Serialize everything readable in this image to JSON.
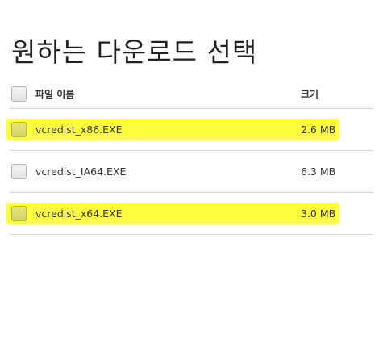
{
  "page": {
    "title": "원하는 다운로드 선택"
  },
  "table": {
    "header": {
      "name": "파일 이름",
      "size": "크기"
    },
    "rows": [
      {
        "name": "vcredist_x86.EXE",
        "size": "2.6 MB",
        "highlighted": true
      },
      {
        "name": "vcredist_IA64.EXE",
        "size": "6.3 MB",
        "highlighted": false
      },
      {
        "name": "vcredist_x64.EXE",
        "size": "3.0 MB",
        "highlighted": true
      }
    ]
  },
  "colors": {
    "highlight": "#ffff33",
    "divider": "#d6d6d6",
    "text": "#333333"
  }
}
